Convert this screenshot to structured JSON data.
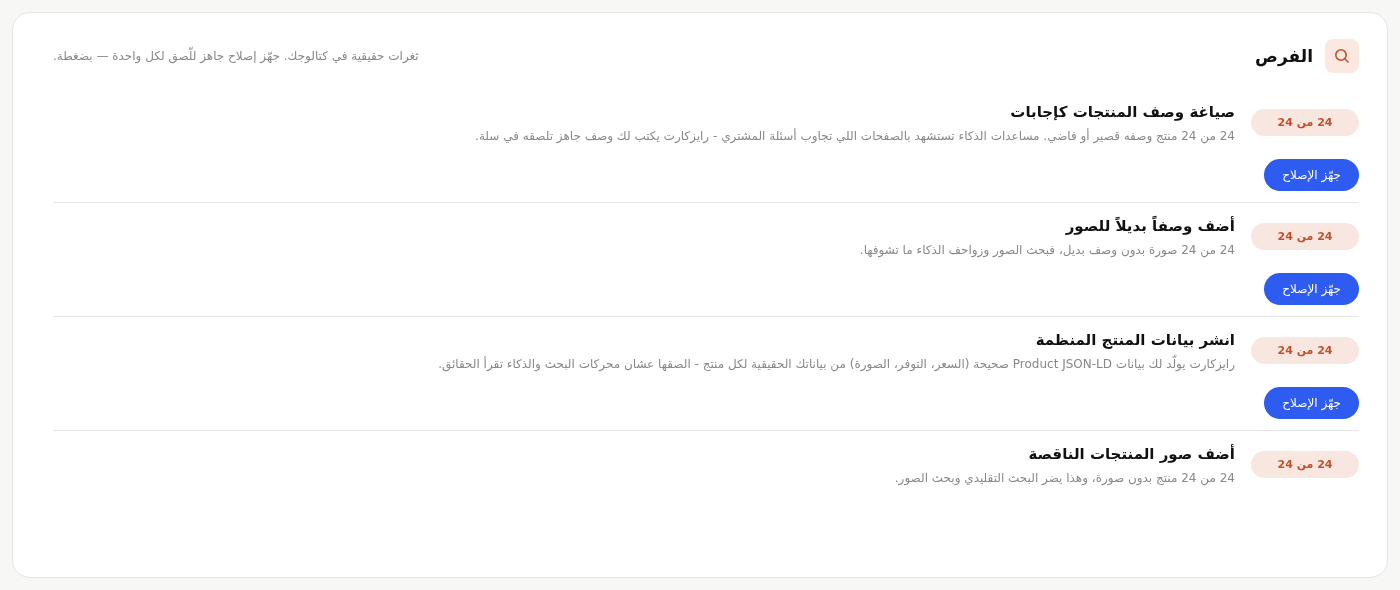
{
  "header": {
    "title": "الفرص",
    "subtitle": "ثغرات حقيقية في كتالوجك. جهّز إصلاح جاهز للّصق لكل واحدة — بضغطة."
  },
  "items": [
    {
      "badge": "24 من 24",
      "title": "صياغة وصف المنتجات كإجابات",
      "description": "24 من 24 منتج وصفه قصير أو فاضي. مساعدات الذكاء تستشهد بالصفحات اللي تجاوب أسئلة المشتري - رايزكارت يكتب لك وصف جاهز تلصقه في سلة.",
      "button": "جهّز الإصلاح"
    },
    {
      "badge": "24 من 24",
      "title": "أضف وصفاً بديلاً للصور",
      "description": "24 من 24 صورة بدون وصف بديل، فبحث الصور وزواحف الذكاء ما تشوفها.",
      "button": "جهّز الإصلاح"
    },
    {
      "badge": "24 من 24",
      "title": "انشر بيانات المنتج المنظمة",
      "description": "رايزكارت يولّد لك بيانات Product JSON-LD صحيحة (السعر، التوفر، الصورة) من بياناتك الحقيقية لكل منتج - الصقها عشان محركات البحث والذكاء تقرأ الحقائق.",
      "button": "جهّز الإصلاح"
    },
    {
      "badge": "24 من 24",
      "title": "أضف صور المنتجات الناقصة",
      "description": "24 من 24 منتج بدون صورة، وهذا يضر البحث التقليدي وبحث الصور."
    }
  ]
}
